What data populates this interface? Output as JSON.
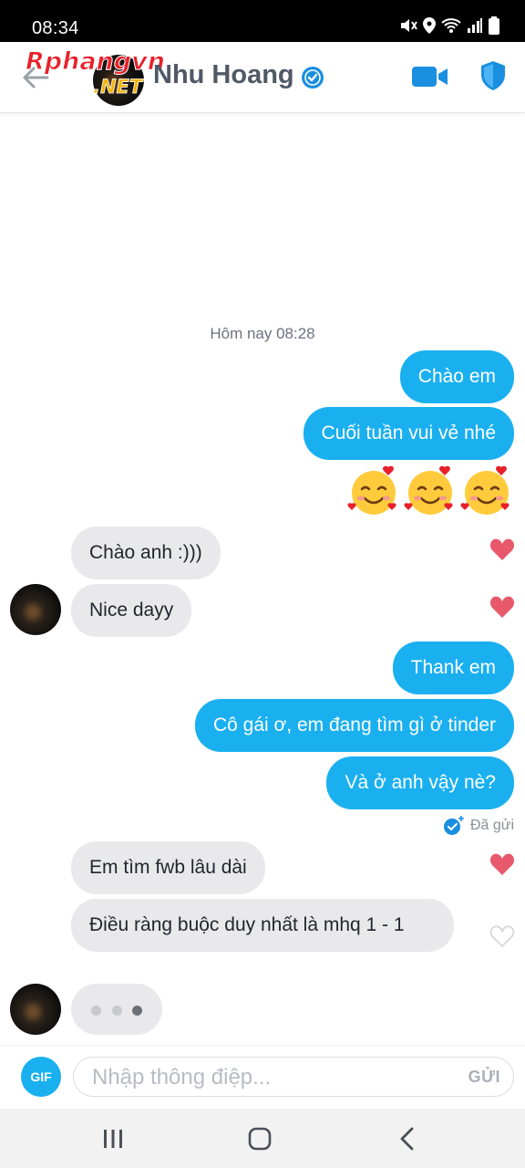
{
  "status_bar": {
    "time": "08:34"
  },
  "watermark": {
    "brand": "Rphangvn",
    "suffix": ".NET"
  },
  "header": {
    "contact_name": "Nhu Hoang"
  },
  "conversation": {
    "timestamp": "Hôm nay 08:28",
    "messages": [
      {
        "direction": "out",
        "text": "Chào em"
      },
      {
        "direction": "out",
        "text": "Cuối tuần vui vẻ nhé"
      },
      {
        "direction": "out",
        "type": "emoji",
        "name": "smiling-face-with-hearts",
        "count": 3
      },
      {
        "direction": "in",
        "text": "Chào anh :)))",
        "liked": true
      },
      {
        "direction": "in",
        "text": "Nice dayy",
        "liked": true
      },
      {
        "direction": "out",
        "text": "Thank em"
      },
      {
        "direction": "out",
        "text": "Cô gái ơ, em đang tìm gì ở tinder"
      },
      {
        "direction": "out",
        "text": "Và ở anh vậy nè?"
      },
      {
        "direction": "in",
        "text": "Em tìm fwb lâu dài",
        "liked": true
      },
      {
        "direction": "in",
        "text": "Điều ràng buộc duy nhất là mhq 1 - 1",
        "liked": false
      }
    ],
    "sent_status": "Đã gửi",
    "typing_indicator": true
  },
  "composer": {
    "gif_label": "GIF",
    "placeholder": "Nhập thông điệp...",
    "send_label": "GỬI"
  },
  "colors": {
    "accent": "#1ab0f0",
    "incoming_bubble": "#e9e9eb",
    "heart_liked": "#e8596b",
    "verified": "#1a8fe0"
  }
}
